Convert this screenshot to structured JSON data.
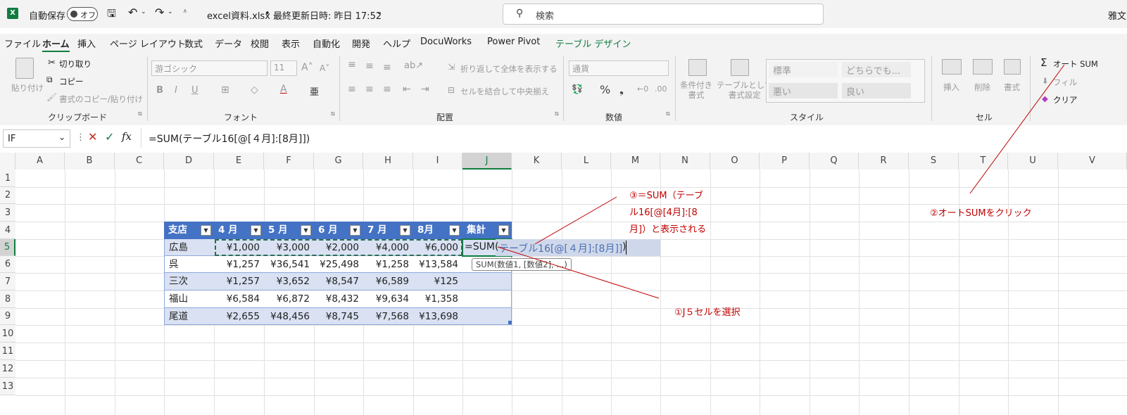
{
  "titlebar": {
    "autosave_label": "自動保存",
    "autosave_state": "オフ",
    "filename": "excel資料.xlsx",
    "separator": "•",
    "last_saved": "最終更新日時: 昨日 17:52",
    "search_placeholder": "検索",
    "user": "雅文"
  },
  "menu": [
    "ファイル",
    "ホーム",
    "挿入",
    "ページ レイアウト",
    "数式",
    "データ",
    "校閲",
    "表示",
    "自動化",
    "開発",
    "ヘルプ",
    "DocuWorks",
    "Power Pivot",
    "テーブル デザイン"
  ],
  "ribbon": {
    "clipboard": {
      "paste": "貼り付け",
      "cut": "切り取り",
      "copy": "コピー",
      "format_painter": "書式のコピー/貼り付け",
      "label": "クリップボード"
    },
    "font": {
      "name": "游ゴシック",
      "size": "11",
      "label": "フォント"
    },
    "alignment": {
      "wrap": "折り返して全体を表示する",
      "merge": "セルを結合して中央揃え",
      "label": "配置"
    },
    "number": {
      "format": "通貨",
      "label": "数値"
    },
    "styles": {
      "conditional": "条件付き\n書式",
      "table_format": "テーブルとして\n書式設定",
      "normal": "標準",
      "neutral": "どちらでも...",
      "bad": "悪い",
      "good": "良い",
      "label": "スタイル"
    },
    "cells": {
      "insert": "挿入",
      "delete": "削除",
      "format": "書式",
      "label": "セル"
    },
    "editing": {
      "autosum": "オート SUM",
      "fill": "フィル",
      "clear": "クリア"
    }
  },
  "formula_bar": {
    "namebox": "IF",
    "fx": "fx",
    "formula": "=SUM(テーブル16[@[４月]:[8月]])"
  },
  "columns": [
    "A",
    "B",
    "C",
    "D",
    "E",
    "F",
    "G",
    "H",
    "I",
    "J",
    "K",
    "L",
    "M",
    "N",
    "O",
    "P",
    "Q",
    "R",
    "S",
    "T",
    "U",
    "V"
  ],
  "rows": [
    "1",
    "2",
    "3",
    "4",
    "5",
    "6",
    "7",
    "8",
    "9",
    "10",
    "11",
    "12",
    "13"
  ],
  "table": {
    "headers": [
      "支店",
      "4 月",
      "5 月",
      "6 月",
      "7 月",
      "8月",
      "集計"
    ],
    "rows": [
      [
        "広島",
        "¥1,000",
        "¥3,000",
        "¥2,000",
        "¥4,000",
        "¥6,000"
      ],
      [
        "呉",
        "¥1,257",
        "¥36,541",
        "¥25,498",
        "¥1,258",
        "¥13,584"
      ],
      [
        "三次",
        "¥1,257",
        "¥3,652",
        "¥8,547",
        "¥6,589",
        "¥125"
      ],
      [
        "福山",
        "¥6,584",
        "¥6,872",
        "¥8,432",
        "¥9,634",
        "¥1,358"
      ],
      [
        "尾道",
        "¥2,655",
        "¥48,456",
        "¥8,745",
        "¥7,568",
        "¥13,698"
      ]
    ],
    "editing_prefix": "=SUM(",
    "editing_ref": "テーブル16[@[４月]:[8月]]",
    "editing_suffix": ")",
    "tooltip": "SUM(数値1, [数値2], ...)"
  },
  "annotations": {
    "a1": "①J５セルを選択",
    "a2": "②オートSUMをクリック",
    "a3_l1": "③＝SUM（テーブ",
    "a3_l2": "ル16[@[4月]:[8",
    "a3_l3": "月]）と表示される"
  },
  "colors": {
    "excel_green": "#107c41",
    "table_header": "#4472c4",
    "band": "#d9e1f2",
    "annotation": "#c00000"
  }
}
